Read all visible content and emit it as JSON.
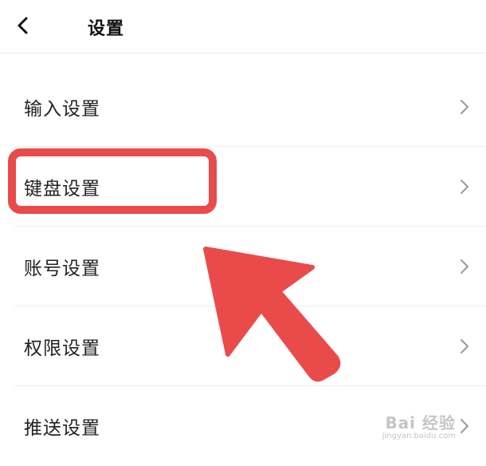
{
  "header": {
    "title": "设置",
    "back_icon": "chevron-left-icon"
  },
  "settings_list": {
    "items": [
      {
        "label": "输入设置",
        "icon": "chevron-right-icon"
      },
      {
        "label": "键盘设置",
        "icon": "chevron-right-icon",
        "highlighted": true
      },
      {
        "label": "账号设置",
        "icon": "chevron-right-icon"
      },
      {
        "label": "权限设置",
        "icon": "chevron-right-icon"
      },
      {
        "label": "推送设置",
        "icon": "chevron-right-icon"
      }
    ]
  },
  "annotation": {
    "highlight_color": "#e94b4b",
    "arrow_color": "#e94b4b"
  },
  "watermark": {
    "main": "Bai 经验",
    "sub": "jingyan.baidu.com"
  }
}
